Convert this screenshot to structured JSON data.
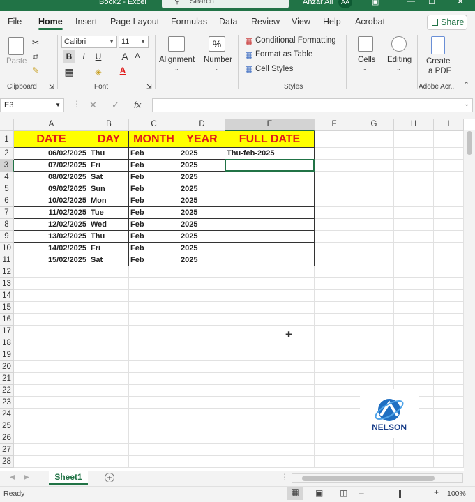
{
  "titlebar": {
    "doc": "Book2 - Excel",
    "search_placeholder": "Search",
    "user": "Anzar Ali",
    "initials": "AA"
  },
  "tabs": [
    "File",
    "Home",
    "Insert",
    "Page Layout",
    "Formulas",
    "Data",
    "Review",
    "View",
    "Help",
    "Acrobat"
  ],
  "share_label": "Share",
  "ribbon": {
    "clipboard": {
      "paste": "Paste",
      "group": "Clipboard"
    },
    "font": {
      "name": "Calibri",
      "size": "11",
      "bold": "B",
      "italic": "I",
      "underline": "U",
      "group": "Font"
    },
    "alignment": "Alignment",
    "number": {
      "label": "Number",
      "symbol": "%"
    },
    "styles": {
      "cond": "Conditional Formatting",
      "table": "Format as Table",
      "cell": "Cell Styles",
      "group": "Styles"
    },
    "cells": "Cells",
    "editing": "Editing",
    "pdf": {
      "line1": "Create",
      "line2": "a PDF",
      "group": "Adobe Acr..."
    }
  },
  "namebox": "E3",
  "fx": "fx",
  "columns": [
    "A",
    "B",
    "C",
    "D",
    "E",
    "F",
    "G",
    "H",
    "I"
  ],
  "rows": [
    "1",
    "2",
    "3",
    "4",
    "5",
    "6",
    "7",
    "8",
    "9",
    "10",
    "11",
    "12",
    "13",
    "14",
    "15",
    "16",
    "17",
    "18",
    "19",
    "20",
    "21",
    "22",
    "23",
    "24",
    "25",
    "26",
    "27",
    "28"
  ],
  "headers": [
    "DATE",
    "DAY",
    "MONTH",
    "YEAR",
    "FULL DATE"
  ],
  "data": [
    [
      "06/02/2025",
      "Thu",
      "Feb",
      "2025",
      "Thu-feb-2025"
    ],
    [
      "07/02/2025",
      "Fri",
      "Feb",
      "2025",
      ""
    ],
    [
      "08/02/2025",
      "Sat",
      "Feb",
      "2025",
      ""
    ],
    [
      "09/02/2025",
      "Sun",
      "Feb",
      "2025",
      ""
    ],
    [
      "10/02/2025",
      "Mon",
      "Feb",
      "2025",
      ""
    ],
    [
      "11/02/2025",
      "Tue",
      "Feb",
      "2025",
      ""
    ],
    [
      "12/02/2025",
      "Wed",
      "Feb",
      "2025",
      ""
    ],
    [
      "13/02/2025",
      "Thu",
      "Feb",
      "2025",
      ""
    ],
    [
      "14/02/2025",
      "Fri",
      "Feb",
      "2025",
      ""
    ],
    [
      "15/02/2025",
      "Sat",
      "Feb",
      "2025",
      ""
    ]
  ],
  "sheet": "Sheet1",
  "status": {
    "ready": "Ready",
    "zoom": "100%"
  },
  "logo_text": "NELSON",
  "colors": {
    "accent": "#217346",
    "header_fill": "#ffff00",
    "header_text": "#e01b1b"
  }
}
